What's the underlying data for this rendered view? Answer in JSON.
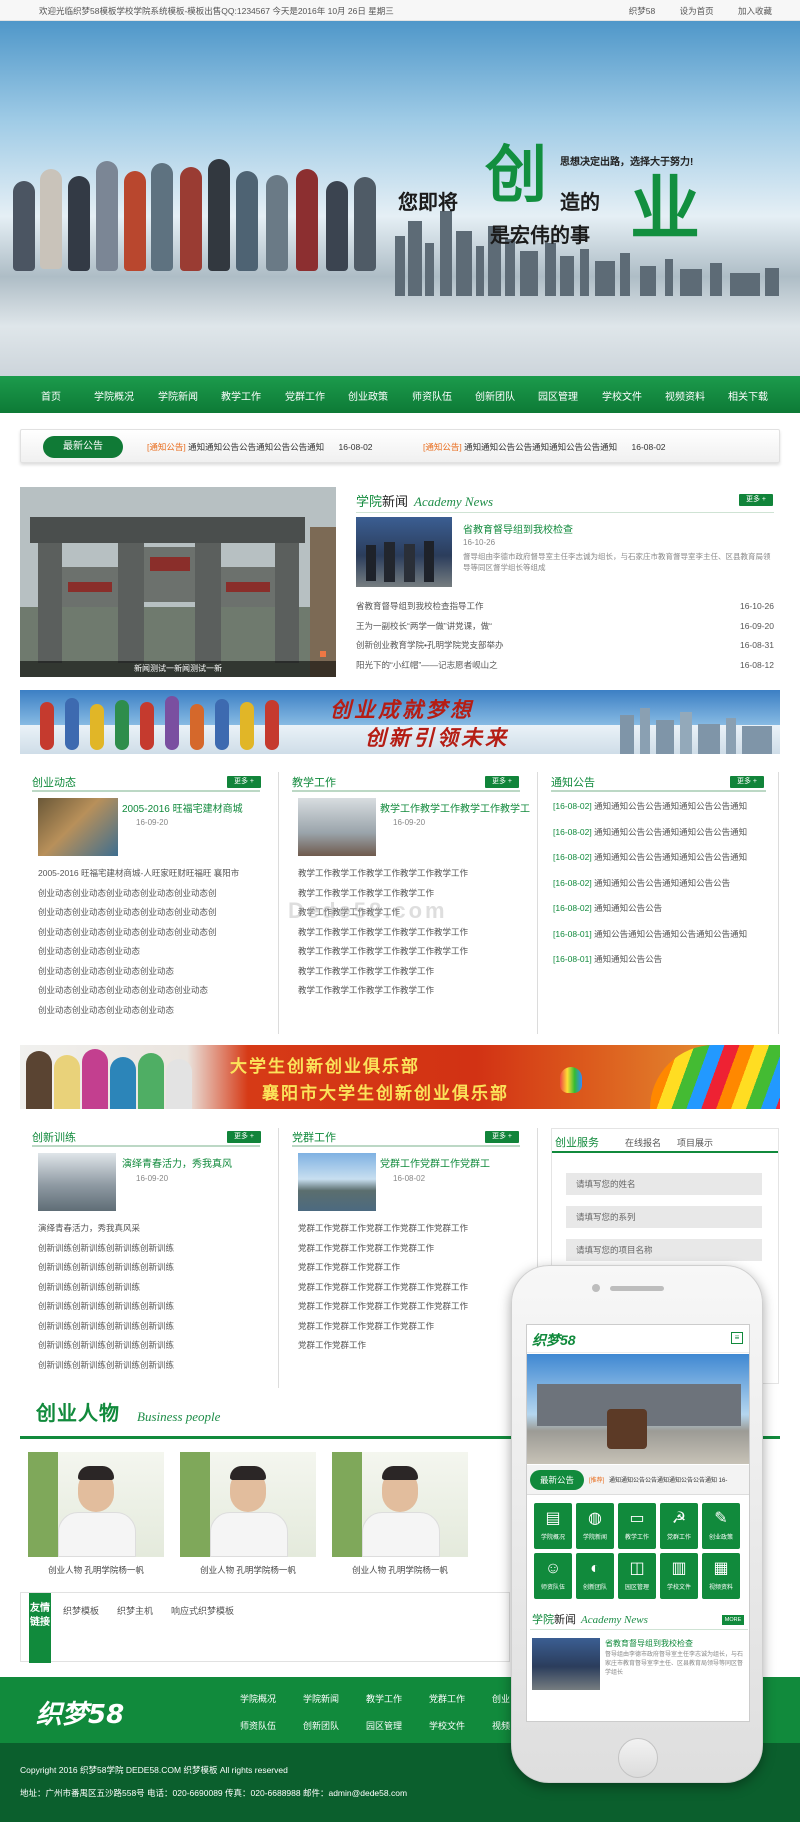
{
  "topbar": {
    "welcome": "欢迎光临织梦58模板学校学院系统模板-模板出售QQ:1234567 今天是2016年 10月 26日 星期三",
    "links": [
      "织梦58",
      "设为首页",
      "加入收藏"
    ]
  },
  "hero": {
    "slogan_small": "思想决定出路，选择大于努力!",
    "slogan_1": "您即将",
    "slogan_big_1": "创",
    "slogan_2": "造的",
    "slogan_3": "是宏伟的事",
    "slogan_big_2": "业"
  },
  "nav": [
    "首页",
    "学院概况",
    "学院新闻",
    "教学工作",
    "党群工作",
    "创业政策",
    "师资队伍",
    "创新团队",
    "园区管理",
    "学校文件",
    "视频资料",
    "相关下载"
  ],
  "notice": {
    "label": "最新公告",
    "items": [
      {
        "tag": "[通知公告]",
        "text": "通知通知公告公告通知公告公告通知",
        "date": "16-08-02"
      },
      {
        "tag": "[通知公告]",
        "text": "通知通知公告公告通知通知公告公告通知",
        "date": "16-08-02"
      }
    ]
  },
  "slide_caption": "新闻测试一新闻测试一新",
  "academy_news": {
    "title_cn_green": "学院",
    "title_cn_dark": "新闻",
    "title_en": "Academy News",
    "more": "更多 +",
    "featured": {
      "title": "省教育督导组到我校检查",
      "date": "16-10-26",
      "desc": "督导组由李德市政府督导室主任李志诚为组长，与石家庄市教育督导室李主任、区县教育局领导等同区督学组长等组成"
    },
    "items": [
      {
        "text": "省教育督导组到我校检查指导工作",
        "date": "16-10-26"
      },
      {
        "text": "王为一副校长“两学一做”讲党课，做“",
        "date": "16-09-20"
      },
      {
        "text": "创新创业教育学院•孔明学院党支部举办",
        "date": "16-08-31"
      },
      {
        "text": "阳光下的“小红帽”——记志愿者岘山之",
        "date": "16-08-12"
      }
    ]
  },
  "banner1": {
    "line1": "创业成就梦想",
    "line2": "创新引领未来"
  },
  "banner2": {
    "line1": "大学生创新创业俱乐部",
    "line2": "襄阳市大学生创新创业俱乐部"
  },
  "cols_row1": [
    {
      "title": "创业动态",
      "more": "更多 +",
      "featured": {
        "title": "2005-2016 旺福宅建材商城",
        "date": "16-09-20"
      },
      "items": [
        "2005-2016 旺福宅建材商城-人旺家旺财旺福旺 襄阳市",
        "创业动态创业动态创业动态创业动态创业动态创",
        "创业动态创业动态创业动态创业动态创业动态创",
        "创业动态创业动态创业动态创业动态创业动态创",
        "创业动态创业动态创业动态",
        "创业动态创业动态创业动态创业动态",
        "创业动态创业动态创业动态创业动态创业动态",
        "创业动态创业动态创业动态创业动态"
      ]
    },
    {
      "title": "教学工作",
      "more": "更多 +",
      "featured": {
        "title": "教学工作教学工作教学工作教学工",
        "date": "16-09-20"
      },
      "items": [
        "教学工作教学工作教学工作教学工作教学工作",
        "教学工作教学工作教学工作教学工作",
        "教学工作教学工作教学工作",
        "教学工作教学工作教学工作教学工作教学工作",
        "教学工作教学工作教学工作教学工作教学工作",
        "教学工作教学工作教学工作教学工作",
        "教学工作教学工作教学工作教学工作"
      ]
    },
    {
      "title": "通知公告",
      "more": "更多 +",
      "items": [
        {
          "tag": "[16-08-02]",
          "text": "通知通知公告公告通知通知公告公告通知"
        },
        {
          "tag": "[16-08-02]",
          "text": "通知通知公告公告通知通知公告公告通知"
        },
        {
          "tag": "[16-08-02]",
          "text": "通知通知公告公告通知通知公告公告通知"
        },
        {
          "tag": "[16-08-02]",
          "text": "通知通知公告公告通知通知公告公告"
        },
        {
          "tag": "[16-08-02]",
          "text": "通知通知公告公告"
        },
        {
          "tag": "[16-08-01]",
          "text": "通知公告通知公告通知公告通知公告通知"
        },
        {
          "tag": "[16-08-01]",
          "text": "通知通知公告公告"
        }
      ]
    }
  ],
  "cols_row2": [
    {
      "title": "创新训练",
      "more": "更多 +",
      "featured": {
        "title": "演绎青春活力，秀我真风",
        "date": "16-09-20"
      },
      "items": [
        "演绎青春活力，秀我真风采",
        "创新训练创新训练创新训练创新训练",
        "创新训练创新训练创新训练创新训练",
        "创新训练创新训练创新训练",
        "创新训练创新训练创新训练创新训练",
        "创新训练创新训练创新训练创新训练",
        "创新训练创新训练创新训练创新训练",
        "创新训练创新训练创新训练创新训练"
      ]
    },
    {
      "title": "党群工作",
      "more": "更多 +",
      "featured": {
        "title": "党群工作党群工作党群工",
        "date": "16-08-02"
      },
      "items": [
        "党群工作党群工作党群工作党群工作党群工作",
        "党群工作党群工作党群工作党群工作",
        "党群工作党群工作党群工作",
        "党群工作党群工作党群工作党群工作党群工作",
        "党群工作党群工作党群工作党群工作党群工作",
        "党群工作党群工作党群工作党群工作",
        "党群工作党群工作"
      ]
    }
  ],
  "service": {
    "tabs": [
      "创业服务",
      "在线报名",
      "项目展示"
    ],
    "fields": [
      "请填写您的姓名",
      "请填写您的系列",
      "请填写您的项目名称"
    ]
  },
  "people": {
    "title_cn": "创业人物",
    "title_en": "Business people",
    "cards": [
      "创业人物 孔明学院杨一帆",
      "创业人物 孔明学院杨一帆",
      "创业人物 孔明学院杨一帆"
    ]
  },
  "links": {
    "label": "友情链接",
    "items": [
      "织梦模板",
      "织梦主机",
      "响应式织梦模板"
    ]
  },
  "footer": {
    "logo": "织梦58",
    "nav_row1": [
      "学院概况",
      "学院新闻",
      "教学工作",
      "党群工作",
      "创业"
    ],
    "nav_row2": [
      "师资队伍",
      "创新团队",
      "园区管理",
      "学校文件",
      "视频"
    ],
    "copyright": "Copyright 2016 织梦58学院 DEDE58.COM 织梦模板 All rights reserved",
    "address": "地址：广州市番禺区五沙路558号 电话：020-6690089 传真：020-6688988 邮件：admin@dede58.com"
  },
  "watermark": "Dede58.com",
  "phone": {
    "logo": "织梦58",
    "notice_label": "最新公告",
    "notice_tag": "[推荐]",
    "notice_text": "通知通知公告公告通知通知公告公告通知 16-",
    "tiles": [
      "学院概况",
      "学院新闻",
      "教学工作",
      "党群工作",
      "创业政策",
      "师资队伍",
      "创新团队",
      "园区管理",
      "学校文件",
      "视频资料"
    ],
    "news_title_green": "学院",
    "news_title_dark": "新闻",
    "news_title_en": "Academy News",
    "more": "MORE",
    "news_item_title": "省教育督导组到我校检查",
    "news_item_desc": "督导组由李德市政府督导室主任李志诚为组长，与石家庄市教育督导室李主任、区县教育局领导等同区督学组长"
  },
  "colors": {
    "brand_green": "#118a3c",
    "dark_green": "#0b5f2d",
    "accent_orange": "#e96c1c"
  }
}
